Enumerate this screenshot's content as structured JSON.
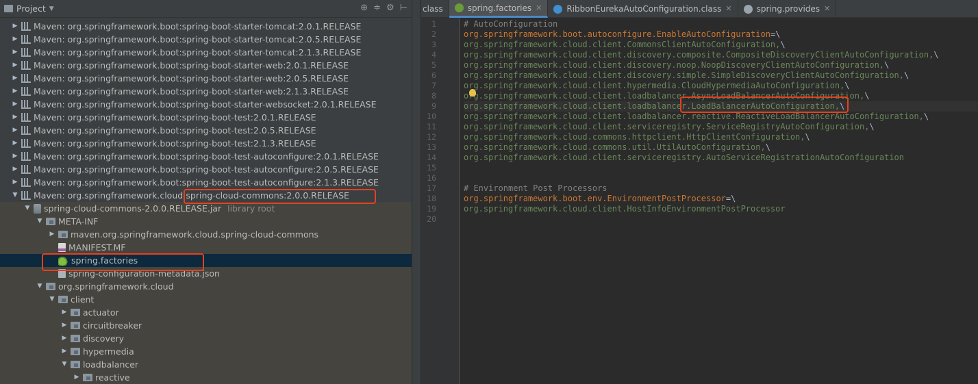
{
  "project_panel": {
    "title": "Project",
    "tools": [
      "⊕",
      "≑",
      "⚙",
      "⊢"
    ]
  },
  "tree": [
    {
      "label": "Maven: org.springframework.boot:spring-boot-starter-tomcat:2.0.1.RELEASE",
      "depth": 0,
      "expanded": false,
      "icon": "library-icon"
    },
    {
      "label": "Maven: org.springframework.boot:spring-boot-starter-tomcat:2.0.5.RELEASE",
      "depth": 0,
      "expanded": false,
      "icon": "library-icon"
    },
    {
      "label": "Maven: org.springframework.boot:spring-boot-starter-tomcat:2.1.3.RELEASE",
      "depth": 0,
      "expanded": false,
      "icon": "library-icon"
    },
    {
      "label": "Maven: org.springframework.boot:spring-boot-starter-web:2.0.1.RELEASE",
      "depth": 0,
      "expanded": false,
      "icon": "library-icon"
    },
    {
      "label": "Maven: org.springframework.boot:spring-boot-starter-web:2.0.5.RELEASE",
      "depth": 0,
      "expanded": false,
      "icon": "library-icon"
    },
    {
      "label": "Maven: org.springframework.boot:spring-boot-starter-web:2.1.3.RELEASE",
      "depth": 0,
      "expanded": false,
      "icon": "library-icon"
    },
    {
      "label": "Maven: org.springframework.boot:spring-boot-starter-websocket:2.0.1.RELEASE",
      "depth": 0,
      "expanded": false,
      "icon": "library-icon"
    },
    {
      "label": "Maven: org.springframework.boot:spring-boot-test:2.0.1.RELEASE",
      "depth": 0,
      "expanded": false,
      "icon": "library-icon"
    },
    {
      "label": "Maven: org.springframework.boot:spring-boot-test:2.0.5.RELEASE",
      "depth": 0,
      "expanded": false,
      "icon": "library-icon"
    },
    {
      "label": "Maven: org.springframework.boot:spring-boot-test:2.1.3.RELEASE",
      "depth": 0,
      "expanded": false,
      "icon": "library-icon"
    },
    {
      "label": "Maven: org.springframework.boot:spring-boot-test-autoconfigure:2.0.1.RELEASE",
      "depth": 0,
      "expanded": false,
      "icon": "library-icon"
    },
    {
      "label": "Maven: org.springframework.boot:spring-boot-test-autoconfigure:2.0.5.RELEASE",
      "depth": 0,
      "expanded": false,
      "icon": "library-icon"
    },
    {
      "label": "Maven: org.springframework.boot:spring-boot-test-autoconfigure:2.1.3.RELEASE",
      "depth": 0,
      "expanded": false,
      "icon": "library-icon"
    },
    {
      "label": "Maven: org.springframework.cloud:spring-cloud-commons:2.0.0.RELEASE",
      "depth": 0,
      "expanded": true,
      "icon": "library-icon"
    },
    {
      "label": "spring-cloud-commons-2.0.0.RELEASE.jar",
      "suffix": "library root",
      "depth": 1,
      "expanded": true,
      "icon": "jar-icon"
    },
    {
      "label": "META-INF",
      "depth": 2,
      "expanded": true,
      "icon": "folder-icon"
    },
    {
      "label": "maven.org.springframework.cloud.spring-cloud-commons",
      "depth": 3,
      "expanded": false,
      "icon": "folder-icon"
    },
    {
      "label": "MANIFEST.MF",
      "depth": 3,
      "leaf": true,
      "icon": "manifest-file-icon"
    },
    {
      "label": "spring.factories",
      "depth": 3,
      "leaf": true,
      "icon": "spring-leaf-icon",
      "selected": true
    },
    {
      "label": "spring-configuration-metadata.json",
      "depth": 3,
      "leaf": true,
      "icon": "json-file-icon"
    },
    {
      "label": "org.springframework.cloud",
      "depth": 2,
      "expanded": true,
      "icon": "folder-icon"
    },
    {
      "label": "client",
      "depth": 3,
      "expanded": true,
      "icon": "folder-icon"
    },
    {
      "label": "actuator",
      "depth": 4,
      "expanded": false,
      "icon": "folder-icon"
    },
    {
      "label": "circuitbreaker",
      "depth": 4,
      "expanded": false,
      "icon": "folder-icon"
    },
    {
      "label": "discovery",
      "depth": 4,
      "expanded": false,
      "icon": "folder-icon"
    },
    {
      "label": "hypermedia",
      "depth": 4,
      "expanded": false,
      "icon": "folder-icon"
    },
    {
      "label": "loadbalancer",
      "depth": 4,
      "expanded": true,
      "icon": "folder-icon"
    },
    {
      "label": "reactive",
      "depth": 5,
      "expanded": false,
      "icon": "folder-icon"
    }
  ],
  "tabs": [
    {
      "label": "class",
      "partial": true
    },
    {
      "label": "spring.factories",
      "active": true,
      "icon": "spring-leaf-icon",
      "color": "#6a9c3a"
    },
    {
      "label": "RibbonEurekaAutoConfiguration.class",
      "icon": "class-file-icon",
      "color": "#3f8fd1"
    },
    {
      "label": "spring.provides",
      "icon": "file-icon",
      "color": "#9aa4ad"
    }
  ],
  "code_lines": [
    {
      "n": "1",
      "segs": [
        {
          "t": "# AutoConfiguration",
          "k": "com"
        }
      ]
    },
    {
      "n": "2",
      "segs": [
        {
          "t": "org.springframework.boot.autoconfigure.EnableAutoConfiguration",
          "k": "key"
        },
        {
          "t": "=\\",
          "k": "op"
        }
      ]
    },
    {
      "n": "3",
      "segs": [
        {
          "t": "org.springframework.cloud.client.CommonsClientAutoConfiguration,",
          "k": "val"
        },
        {
          "t": "\\",
          "k": "op"
        }
      ]
    },
    {
      "n": "4",
      "segs": [
        {
          "t": "org.springframework.cloud.client.discovery.composite.CompositeDiscoveryClientAutoConfiguration,",
          "k": "val"
        },
        {
          "t": "\\",
          "k": "op"
        }
      ]
    },
    {
      "n": "5",
      "segs": [
        {
          "t": "org.springframework.cloud.client.discovery.noop.NoopDiscoveryClientAutoConfiguration,",
          "k": "val"
        },
        {
          "t": "\\",
          "k": "op"
        }
      ]
    },
    {
      "n": "6",
      "segs": [
        {
          "t": "org.springframework.cloud.client.discovery.simple.SimpleDiscoveryClientAutoConfiguration,",
          "k": "val"
        },
        {
          "t": "\\",
          "k": "op"
        }
      ]
    },
    {
      "n": "7",
      "segs": [
        {
          "t": "org.springframework.cloud.client.hypermedia.CloudHypermediaAutoConfiguration,",
          "k": "val"
        },
        {
          "t": "\\",
          "k": "op"
        }
      ]
    },
    {
      "n": "8",
      "segs": [
        {
          "t": "org.springframework.cloud.client.loadbalancer.AsyncLoadBalancerAutoConfiguration,",
          "k": "val"
        },
        {
          "t": "\\",
          "k": "op"
        }
      ]
    },
    {
      "n": "9",
      "current": true,
      "segs": [
        {
          "t": "org.springframework.cloud.client.loadbalancer.LoadBalancerAutoConfiguration,",
          "k": "val"
        },
        {
          "t": "\\",
          "k": "op"
        }
      ]
    },
    {
      "n": "10",
      "segs": [
        {
          "t": "org.springframework.cloud.client.loadbalancer.reactive.ReactiveLoadBalancerAutoConfiguration,",
          "k": "val"
        },
        {
          "t": "\\",
          "k": "op"
        }
      ]
    },
    {
      "n": "11",
      "segs": [
        {
          "t": "org.springframework.cloud.client.serviceregistry.ServiceRegistryAutoConfiguration,",
          "k": "val"
        },
        {
          "t": "\\",
          "k": "op"
        }
      ]
    },
    {
      "n": "12",
      "segs": [
        {
          "t": "org.springframework.cloud.commons.httpclient.HttpClientConfiguration,",
          "k": "val"
        },
        {
          "t": "\\",
          "k": "op"
        }
      ]
    },
    {
      "n": "13",
      "segs": [
        {
          "t": "org.springframework.cloud.commons.util.UtilAutoConfiguration,",
          "k": "val"
        },
        {
          "t": "\\",
          "k": "op"
        }
      ]
    },
    {
      "n": "14",
      "segs": [
        {
          "t": "org.springframework.cloud.client.serviceregistry.AutoServiceRegistrationAutoConfiguration",
          "k": "val"
        }
      ]
    },
    {
      "n": "15",
      "segs": []
    },
    {
      "n": "16",
      "segs": []
    },
    {
      "n": "17",
      "segs": [
        {
          "t": "# Environment Post Processors",
          "k": "com"
        }
      ]
    },
    {
      "n": "18",
      "segs": [
        {
          "t": "org.springframework.boot.env.EnvironmentPostProcessor",
          "k": "key"
        },
        {
          "t": "=\\",
          "k": "op"
        }
      ]
    },
    {
      "n": "19",
      "segs": [
        {
          "t": "org.springframework.cloud.client.HostInfoEnvironmentPostProcessor",
          "k": "val"
        }
      ]
    },
    {
      "n": "20",
      "segs": []
    }
  ],
  "colors": {
    "highlight_box": "#e8401c",
    "comment": "#808080",
    "key": "#cc7832",
    "value": "#6a8759",
    "selection": "#0d293e"
  }
}
